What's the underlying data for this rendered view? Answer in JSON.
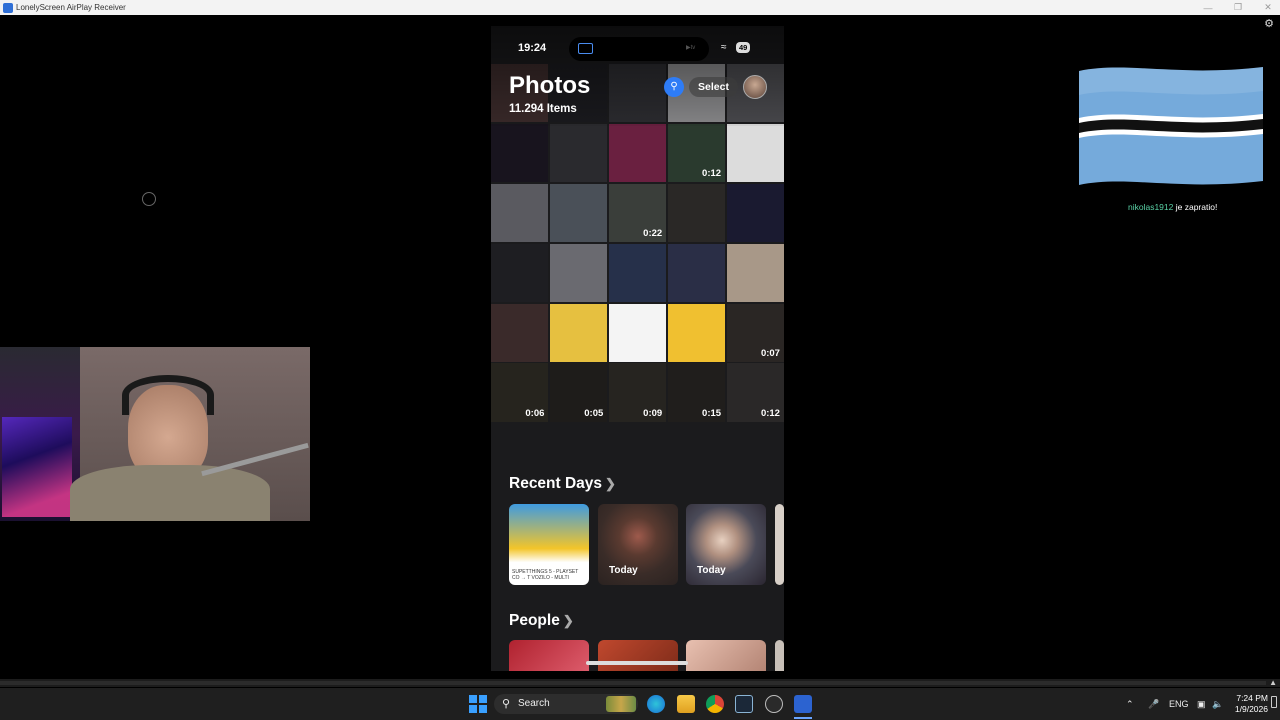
{
  "window": {
    "title": "LonelyScreen AirPlay Receiver"
  },
  "phone": {
    "status": {
      "time": "19:24",
      "battery": "49",
      "island_badge": "▶tv"
    },
    "header": {
      "title": "Photos",
      "count": "11.294 Items",
      "select_label": "Select"
    },
    "grid_tiles": [
      {
        "dur": ""
      },
      {
        "dur": ""
      },
      {
        "dur": ""
      },
      {
        "dur": ""
      },
      {
        "dur": ""
      },
      {
        "dur": ""
      },
      {
        "dur": ""
      },
      {
        "dur": ""
      },
      {
        "dur": "0:12"
      },
      {
        "dur": ""
      },
      {
        "dur": ""
      },
      {
        "dur": ""
      },
      {
        "dur": "0:22"
      },
      {
        "dur": ""
      },
      {
        "dur": ""
      },
      {
        "dur": ""
      },
      {
        "dur": ""
      },
      {
        "dur": ""
      },
      {
        "dur": ""
      },
      {
        "dur": ""
      },
      {
        "dur": ""
      },
      {
        "dur": ""
      },
      {
        "dur": ""
      },
      {
        "dur": ""
      },
      {
        "dur": "0:07"
      },
      {
        "dur": "0:06"
      },
      {
        "dur": "0:05"
      },
      {
        "dur": "0:09"
      },
      {
        "dur": "0:15"
      },
      {
        "dur": "0:12"
      }
    ],
    "recent_days": {
      "title": "Recent Days",
      "cards": [
        {
          "label": "",
          "caption": "SUPETTHINGS 5 - PLAYSET CO → T VOZILO - MULTI"
        },
        {
          "label": "Today",
          "caption": ""
        },
        {
          "label": "Today",
          "caption": ""
        }
      ]
    },
    "people": {
      "title": "People"
    }
  },
  "overlay": {
    "follower": "nikolas1912",
    "follow_text": "je zapratio!"
  },
  "taskbar": {
    "search_label": "Search",
    "lang": "ENG",
    "time": "7:24 PM",
    "date": "1/9/2026"
  },
  "colors": {
    "accent_blue": "#2e7cf6",
    "flag_blue": "#75aadb",
    "follower_green": "#59d1a5"
  }
}
